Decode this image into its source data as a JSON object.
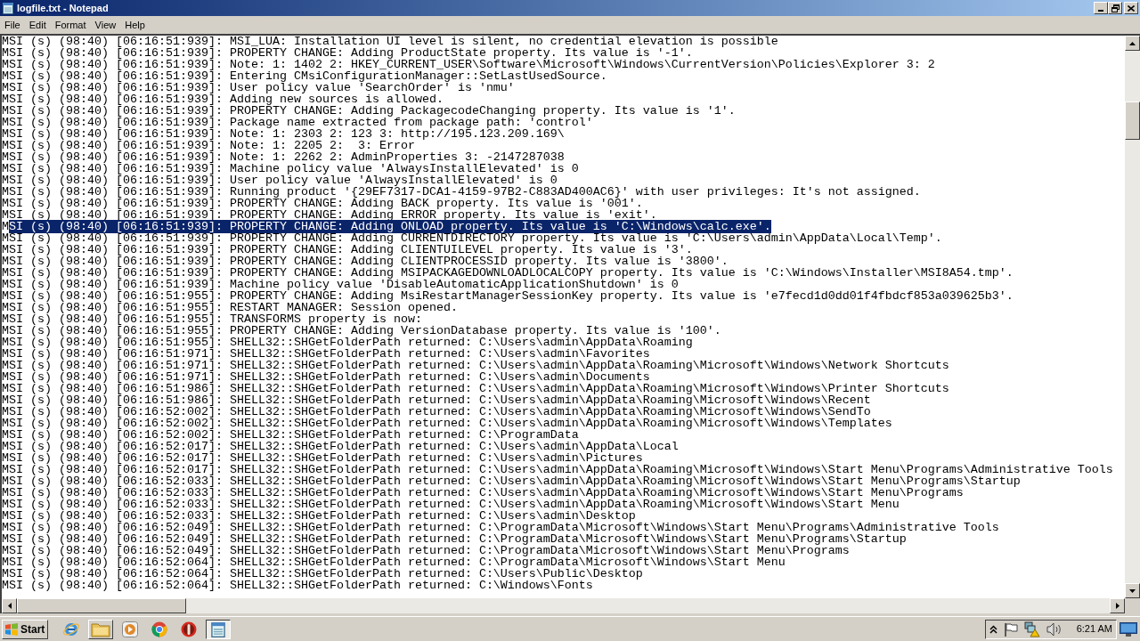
{
  "window": {
    "title": "logfile.txt - Notepad"
  },
  "menu": [
    "File",
    "Edit",
    "Format",
    "View",
    "Help"
  ],
  "lines": [
    {
      "text": "MSI (s) (98:40) [06:16:51:939]: MSI_LUA: Installation UI level is silent, no credential elevation is possible",
      "selected": false
    },
    {
      "text": "MSI (s) (98:40) [06:16:51:939]: PROPERTY CHANGE: Adding ProductState property. Its value is '-1'.",
      "selected": false
    },
    {
      "text": "MSI (s) (98:40) [06:16:51:939]: Note: 1: 1402 2: HKEY_CURRENT_USER\\Software\\Microsoft\\Windows\\CurrentVersion\\Policies\\Explorer 3: 2",
      "selected": false
    },
    {
      "text": "MSI (s) (98:40) [06:16:51:939]: Entering CMsiConfigurationManager::SetLastUsedSource.",
      "selected": false
    },
    {
      "text": "MSI (s) (98:40) [06:16:51:939]: User policy value 'SearchOrder' is 'nmu'",
      "selected": false
    },
    {
      "text": "MSI (s) (98:40) [06:16:51:939]: Adding new sources is allowed.",
      "selected": false
    },
    {
      "text": "MSI (s) (98:40) [06:16:51:939]: PROPERTY CHANGE: Adding PackagecodeChanging property. Its value is '1'.",
      "selected": false
    },
    {
      "text": "MSI (s) (98:40) [06:16:51:939]: Package name extracted from package path: 'control'",
      "selected": false
    },
    {
      "text": "MSI (s) (98:40) [06:16:51:939]: Note: 1: 2303 2: 123 3: http://195.123.209.169\\",
      "selected": false
    },
    {
      "text": "MSI (s) (98:40) [06:16:51:939]: Note: 1: 2205 2:  3: Error",
      "selected": false
    },
    {
      "text": "MSI (s) (98:40) [06:16:51:939]: Note: 1: 2262 2: AdminProperties 3: -2147287038",
      "selected": false
    },
    {
      "text": "MSI (s) (98:40) [06:16:51:939]: Machine policy value 'AlwaysInstallElevated' is 0",
      "selected": false
    },
    {
      "text": "MSI (s) (98:40) [06:16:51:939]: User policy value 'AlwaysInstallElevated' is 0",
      "selected": false
    },
    {
      "text": "MSI (s) (98:40) [06:16:51:939]: Running product '{29EF7317-DCA1-4159-97B2-C883AD400AC6}' with user privileges: It's not assigned.",
      "selected": false
    },
    {
      "text": "MSI (s) (98:40) [06:16:51:939]: PROPERTY CHANGE: Adding BACK property. Its value is '001'.",
      "selected": false
    },
    {
      "text": "MSI (s) (98:40) [06:16:51:939]: PROPERTY CHANGE: Adding ERROR property. Its value is 'exit'.",
      "selected": false
    },
    {
      "text": "M",
      "selected_text": "SI (s) (98:40) [06:16:51:939]: PROPERTY CHANGE: Adding ONLOAD property. Its value is 'C:\\Windows\\calc.exe'.",
      "selected": true
    },
    {
      "text": "MSI (s) (98:40) [06:16:51:939]: PROPERTY CHANGE: Adding CURRENTDIRECTORY property. Its value is 'C:\\Users\\admin\\AppData\\Local\\Temp'.",
      "selected": false
    },
    {
      "text": "MSI (s) (98:40) [06:16:51:939]: PROPERTY CHANGE: Adding CLIENTUILEVEL property. Its value is '3'.",
      "selected": false
    },
    {
      "text": "MSI (s) (98:40) [06:16:51:939]: PROPERTY CHANGE: Adding CLIENTPROCESSID property. Its value is '3800'.",
      "selected": false
    },
    {
      "text": "MSI (s) (98:40) [06:16:51:939]: PROPERTY CHANGE: Adding MSIPACKAGEDOWNLOADLOCALCOPY property. Its value is 'C:\\Windows\\Installer\\MSI8A54.tmp'.",
      "selected": false
    },
    {
      "text": "MSI (s) (98:40) [06:16:51:939]: Machine policy value 'DisableAutomaticApplicationShutdown' is 0",
      "selected": false
    },
    {
      "text": "MSI (s) (98:40) [06:16:51:955]: PROPERTY CHANGE: Adding MsiRestartManagerSessionKey property. Its value is 'e7fecd1d0dd01f4fbdcf853a039625b3'.",
      "selected": false
    },
    {
      "text": "MSI (s) (98:40) [06:16:51:955]: RESTART MANAGER: Session opened.",
      "selected": false
    },
    {
      "text": "MSI (s) (98:40) [06:16:51:955]: TRANSFORMS property is now:",
      "selected": false
    },
    {
      "text": "MSI (s) (98:40) [06:16:51:955]: PROPERTY CHANGE: Adding VersionDatabase property. Its value is '100'.",
      "selected": false
    },
    {
      "text": "MSI (s) (98:40) [06:16:51:955]: SHELL32::SHGetFolderPath returned: C:\\Users\\admin\\AppData\\Roaming",
      "selected": false
    },
    {
      "text": "MSI (s) (98:40) [06:16:51:971]: SHELL32::SHGetFolderPath returned: C:\\Users\\admin\\Favorites",
      "selected": false
    },
    {
      "text": "MSI (s) (98:40) [06:16:51:971]: SHELL32::SHGetFolderPath returned: C:\\Users\\admin\\AppData\\Roaming\\Microsoft\\Windows\\Network Shortcuts",
      "selected": false
    },
    {
      "text": "MSI (s) (98:40) [06:16:51:971]: SHELL32::SHGetFolderPath returned: C:\\Users\\admin\\Documents",
      "selected": false
    },
    {
      "text": "MSI (s) (98:40) [06:16:51:986]: SHELL32::SHGetFolderPath returned: C:\\Users\\admin\\AppData\\Roaming\\Microsoft\\Windows\\Printer Shortcuts",
      "selected": false
    },
    {
      "text": "MSI (s) (98:40) [06:16:51:986]: SHELL32::SHGetFolderPath returned: C:\\Users\\admin\\AppData\\Roaming\\Microsoft\\Windows\\Recent",
      "selected": false
    },
    {
      "text": "MSI (s) (98:40) [06:16:52:002]: SHELL32::SHGetFolderPath returned: C:\\Users\\admin\\AppData\\Roaming\\Microsoft\\Windows\\SendTo",
      "selected": false
    },
    {
      "text": "MSI (s) (98:40) [06:16:52:002]: SHELL32::SHGetFolderPath returned: C:\\Users\\admin\\AppData\\Roaming\\Microsoft\\Windows\\Templates",
      "selected": false
    },
    {
      "text": "MSI (s) (98:40) [06:16:52:002]: SHELL32::SHGetFolderPath returned: C:\\ProgramData",
      "selected": false
    },
    {
      "text": "MSI (s) (98:40) [06:16:52:017]: SHELL32::SHGetFolderPath returned: C:\\Users\\admin\\AppData\\Local",
      "selected": false
    },
    {
      "text": "MSI (s) (98:40) [06:16:52:017]: SHELL32::SHGetFolderPath returned: C:\\Users\\admin\\Pictures",
      "selected": false
    },
    {
      "text": "MSI (s) (98:40) [06:16:52:017]: SHELL32::SHGetFolderPath returned: C:\\Users\\admin\\AppData\\Roaming\\Microsoft\\Windows\\Start Menu\\Programs\\Administrative Tools",
      "selected": false
    },
    {
      "text": "MSI (s) (98:40) [06:16:52:033]: SHELL32::SHGetFolderPath returned: C:\\Users\\admin\\AppData\\Roaming\\Microsoft\\Windows\\Start Menu\\Programs\\Startup",
      "selected": false
    },
    {
      "text": "MSI (s) (98:40) [06:16:52:033]: SHELL32::SHGetFolderPath returned: C:\\Users\\admin\\AppData\\Roaming\\Microsoft\\Windows\\Start Menu\\Programs",
      "selected": false
    },
    {
      "text": "MSI (s) (98:40) [06:16:52:033]: SHELL32::SHGetFolderPath returned: C:\\Users\\admin\\AppData\\Roaming\\Microsoft\\Windows\\Start Menu",
      "selected": false
    },
    {
      "text": "MSI (s) (98:40) [06:16:52:033]: SHELL32::SHGetFolderPath returned: C:\\Users\\admin\\Desktop",
      "selected": false
    },
    {
      "text": "MSI (s) (98:40) [06:16:52:049]: SHELL32::SHGetFolderPath returned: C:\\ProgramData\\Microsoft\\Windows\\Start Menu\\Programs\\Administrative Tools",
      "selected": false
    },
    {
      "text": "MSI (s) (98:40) [06:16:52:049]: SHELL32::SHGetFolderPath returned: C:\\ProgramData\\Microsoft\\Windows\\Start Menu\\Programs\\Startup",
      "selected": false
    },
    {
      "text": "MSI (s) (98:40) [06:16:52:049]: SHELL32::SHGetFolderPath returned: C:\\ProgramData\\Microsoft\\Windows\\Start Menu\\Programs",
      "selected": false
    },
    {
      "text": "MSI (s) (98:40) [06:16:52:064]: SHELL32::SHGetFolderPath returned: C:\\ProgramData\\Microsoft\\Windows\\Start Menu",
      "selected": false
    },
    {
      "text": "MSI (s) (98:40) [06:16:52:064]: SHELL32::SHGetFolderPath returned: C:\\Users\\Public\\Desktop",
      "selected": false
    },
    {
      "text": "MSI (s) (98:40) [06:16:52:064]: SHELL32::SHGetFolderPath returned: C:\\Windows\\Fonts",
      "selected": false
    }
  ],
  "taskbar": {
    "start": "Start",
    "items": [
      {
        "kind": "globe",
        "running": false,
        "selected": false
      },
      {
        "kind": "folder",
        "running": true,
        "selected": false
      },
      {
        "kind": "media",
        "running": false,
        "selected": false
      },
      {
        "kind": "circle",
        "running": false,
        "selected": false
      },
      {
        "kind": "disc",
        "running": false,
        "selected": false
      },
      {
        "kind": "notepad",
        "running": true,
        "selected": true
      }
    ],
    "clock": "6:21 AM"
  }
}
